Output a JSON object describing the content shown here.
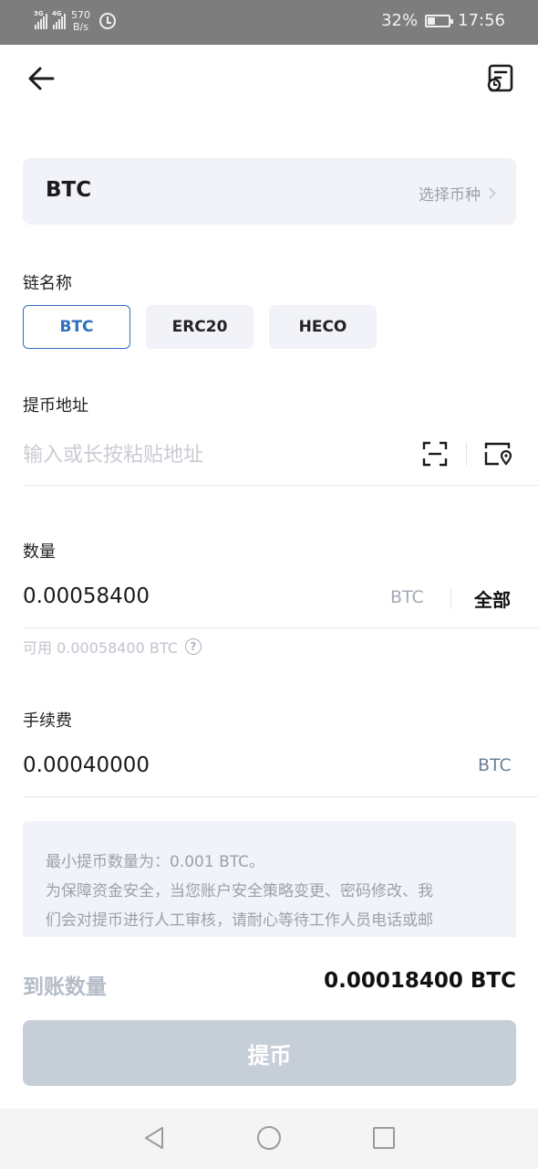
{
  "status_bar": {
    "network1": "3G",
    "network2": "4G",
    "speed_value": "570",
    "speed_unit": "B/s",
    "battery": "32%",
    "time": "17:56"
  },
  "coin": {
    "name": "BTC",
    "select_label": "选择币种"
  },
  "chain": {
    "label": "链名称",
    "options": [
      "BTC",
      "ERC20",
      "HECO"
    ],
    "selected": "BTC"
  },
  "address": {
    "label": "提币地址",
    "placeholder": "输入或长按粘贴地址"
  },
  "amount": {
    "label": "数量",
    "value": "0.00058400",
    "unit": "BTC",
    "all_label": "全部",
    "available": "可用 0.00058400 BTC"
  },
  "fee": {
    "label": "手续费",
    "value": "0.00040000",
    "unit": "BTC"
  },
  "notice": {
    "lines": [
      "最小提币数量为：0.001 BTC。",
      "为保障资金安全，当您账户安全策略变更、密码修改、我",
      "们会对提币进行人工审核，请耐心等待工作人员电话或邮"
    ]
  },
  "received": {
    "label": "到账数量",
    "value": "0.00018400 BTC"
  },
  "submit_label": "提币",
  "colors": {
    "accent": "#2f6fc0",
    "card_bg": "#f2f3f8",
    "disabled_button": "#c6ced8",
    "muted_text": "#9aa1ad"
  }
}
